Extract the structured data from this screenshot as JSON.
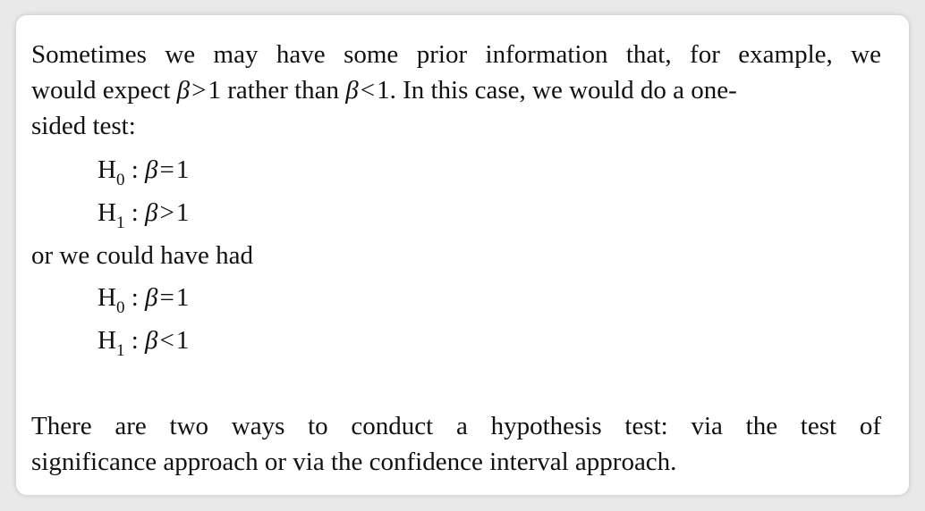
{
  "paragraph1": {
    "line1": "Sometimes we may have some prior information that, for example, we",
    "line2_a": "would expect",
    "line2_beta1": "β",
    "line2_op1": ">",
    "line2_num1": "1",
    "line2_b": "rather than",
    "line2_beta2": "β",
    "line2_op2": "<",
    "line2_num2": "1.",
    "line2_c": "In this case, we would do a one-",
    "line3": "sided test:"
  },
  "test1": {
    "h0": {
      "letter": "H",
      "sub": "0",
      "sep": ":",
      "beta": "β",
      "op": "=",
      "value": "1"
    },
    "h1": {
      "letter": "H",
      "sub": "1",
      "sep": ":",
      "beta": "β",
      "op": ">",
      "value": "1"
    }
  },
  "connector": "or we could have had",
  "test2": {
    "h0": {
      "letter": "H",
      "sub": "0",
      "sep": ":",
      "beta": "β",
      "op": "=",
      "value": "1"
    },
    "h1": {
      "letter": "H",
      "sub": "1",
      "sep": ":",
      "beta": "β",
      "op": "<",
      "value": "1"
    }
  },
  "paragraph2": {
    "line1": "There are two ways to conduct a hypothesis test: via the test of",
    "line2": "significance approach or via the confidence interval approach."
  }
}
